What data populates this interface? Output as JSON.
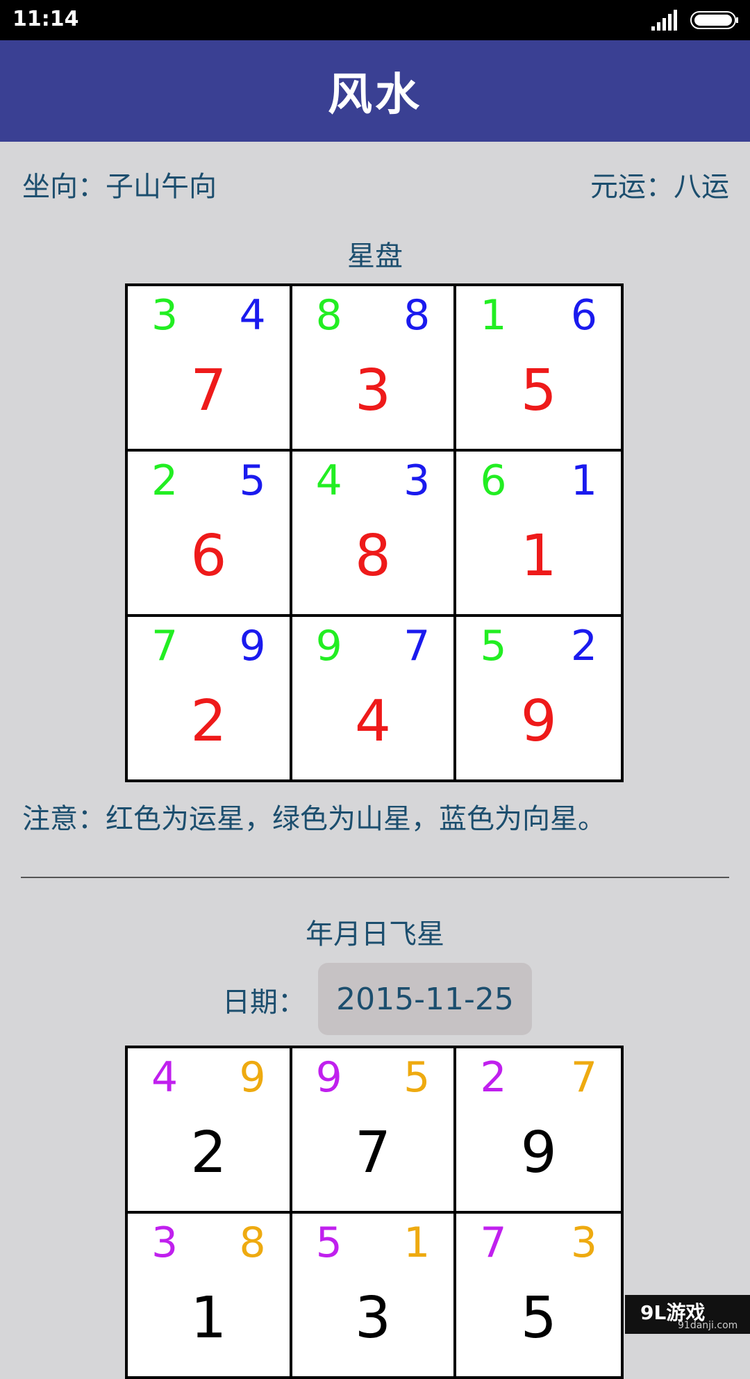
{
  "status_bar": {
    "time": "11:14"
  },
  "app_bar": {
    "title": "风水"
  },
  "info": {
    "orientation": "坐向：子山午向",
    "period": "元运：八运"
  },
  "star_chart": {
    "title": "星盘",
    "colors": {
      "mountain": "#22ee22",
      "facing": "#1a1aee",
      "period": "#ee1a1a"
    },
    "cells": [
      {
        "mountain": "3",
        "facing": "4",
        "period": "7"
      },
      {
        "mountain": "8",
        "facing": "8",
        "period": "3"
      },
      {
        "mountain": "1",
        "facing": "6",
        "period": "5"
      },
      {
        "mountain": "2",
        "facing": "5",
        "period": "6"
      },
      {
        "mountain": "4",
        "facing": "3",
        "period": "8"
      },
      {
        "mountain": "6",
        "facing": "1",
        "period": "1"
      },
      {
        "mountain": "7",
        "facing": "9",
        "period": "2"
      },
      {
        "mountain": "9",
        "facing": "7",
        "period": "4"
      },
      {
        "mountain": "5",
        "facing": "2",
        "period": "9"
      }
    ]
  },
  "note": "注意：红色为运星，绿色为山星，蓝色为向星。",
  "flying_stars": {
    "title": "年月日飞星",
    "date_label": "日期：",
    "date_value": "2015-11-25",
    "colors": {
      "left": "#c020ee",
      "right": "#eeaa10",
      "center": "#000000"
    },
    "cells": [
      {
        "left": "4",
        "right": "9",
        "center": "2"
      },
      {
        "left": "9",
        "right": "5",
        "center": "7"
      },
      {
        "left": "2",
        "right": "7",
        "center": "9"
      },
      {
        "left": "3",
        "right": "8",
        "center": "1"
      },
      {
        "left": "5",
        "right": "1",
        "center": "3"
      },
      {
        "left": "7",
        "right": "3",
        "center": "5"
      }
    ]
  },
  "watermark": {
    "main": "9L游戏",
    "sub": "91danji.com"
  }
}
